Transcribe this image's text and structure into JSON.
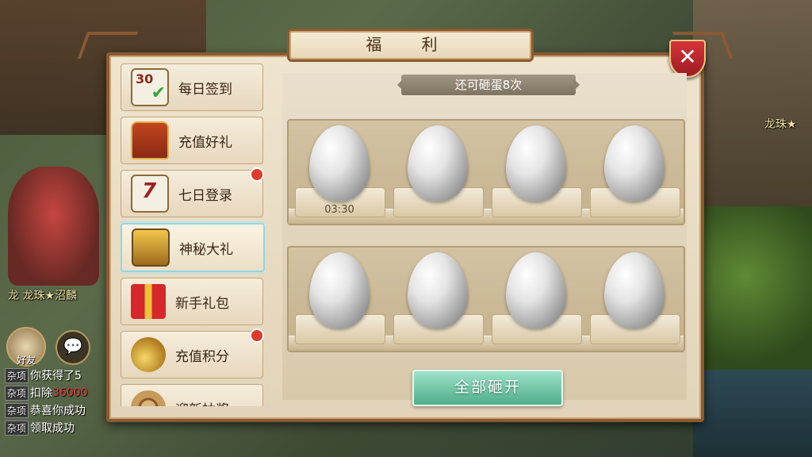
{
  "dialog": {
    "title": "福 利",
    "close_label": "✕"
  },
  "sidebar": {
    "items": [
      {
        "label": "每日签到",
        "icon": "calendar-check-icon",
        "badge": false,
        "icon_text": "30"
      },
      {
        "label": "充值好礼",
        "icon": "treasure-chest-icon",
        "badge": false
      },
      {
        "label": "七日登录",
        "icon": "calendar-seven-icon",
        "badge": true,
        "icon_text": "7"
      },
      {
        "label": "神秘大礼",
        "icon": "gold-chest-icon",
        "badge": false,
        "active": true
      },
      {
        "label": "新手礼包",
        "icon": "gift-box-icon",
        "badge": false
      },
      {
        "label": "充值积分",
        "icon": "gold-coins-icon",
        "badge": true
      },
      {
        "label": "迎新抽奖",
        "icon": "lottery-wheel-icon",
        "badge": false
      }
    ]
  },
  "content": {
    "counter": "还可砸蛋8次",
    "eggs_count": 8,
    "timer": "03:30",
    "break_all_label": "全部砸开"
  },
  "hud": {
    "name_left": "龙 龙珠★沼麟",
    "name_right": "龙珠★",
    "friend_label": "好友",
    "chat": [
      {
        "tag": "杂项",
        "text": "你获得了5",
        "red": ""
      },
      {
        "tag": "杂项",
        "text": "扣除",
        "red": "36000"
      },
      {
        "tag": "杂项",
        "text": "恭喜你成功",
        "red": ""
      },
      {
        "tag": "杂项",
        "text": "领取成功",
        "red": ""
      }
    ]
  },
  "colors": {
    "frame": "#8a5a33",
    "badge": "#e03a2a",
    "active_glow": "#8fd6e6",
    "button": "#4fae8c"
  }
}
